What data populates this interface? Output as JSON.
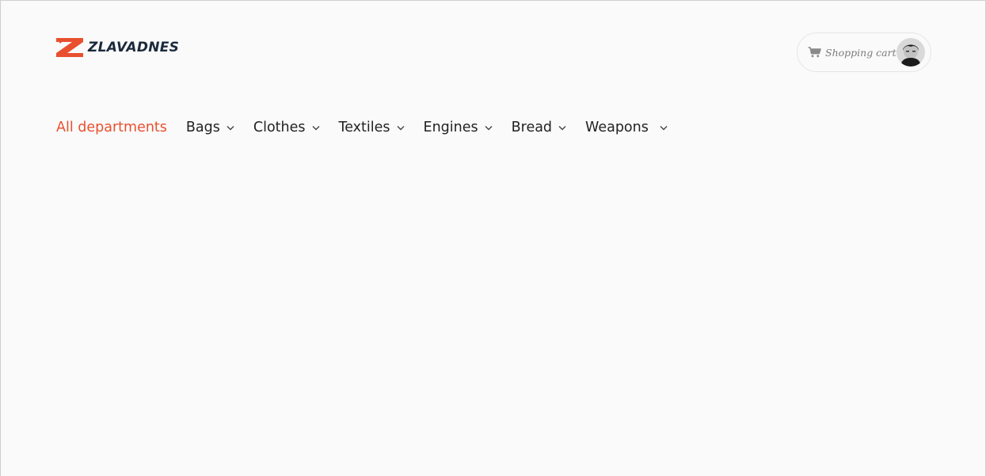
{
  "brand": {
    "name": "ZLAVADNES",
    "accent_color": "#e8502f",
    "text_color": "#1b2a3c"
  },
  "account": {
    "cart_label": "Shopping cart",
    "cart_icon": "shopping-cart-icon",
    "avatar_icon": "user-avatar"
  },
  "nav": {
    "items": [
      {
        "label": "All departments",
        "active": true,
        "has_dropdown": false
      },
      {
        "label": "Bags",
        "active": false,
        "has_dropdown": true
      },
      {
        "label": "Clothes",
        "active": false,
        "has_dropdown": true
      },
      {
        "label": "Textiles",
        "active": false,
        "has_dropdown": true
      },
      {
        "label": "Engines",
        "active": false,
        "has_dropdown": true
      },
      {
        "label": "Bread",
        "active": false,
        "has_dropdown": true
      },
      {
        "label": "Weapons",
        "active": false,
        "has_dropdown": true
      }
    ],
    "dropdown_icon": "chevron-down-icon"
  }
}
